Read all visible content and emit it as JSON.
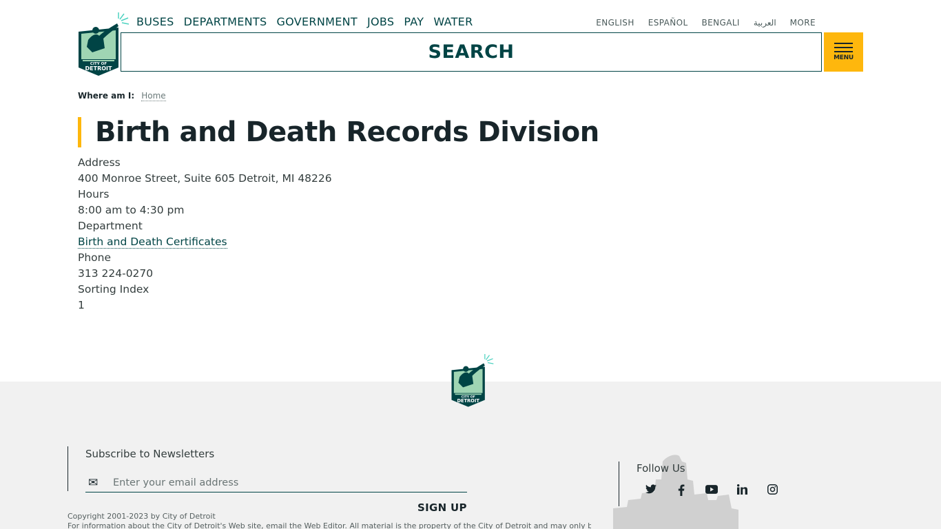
{
  "logo": {
    "text_top": "CITY OF",
    "text_bottom": "DETROIT"
  },
  "topnav": [
    "BUSES",
    "DEPARTMENTS",
    "GOVERNMENT",
    "JOBS",
    "PAY",
    "WATER"
  ],
  "languages": [
    "ENGLISH",
    "ESPAÑOL",
    "BENGALI",
    "العربية",
    "MORE"
  ],
  "search": {
    "label": "SEARCH"
  },
  "menu": {
    "label": "MENU"
  },
  "breadcrumb": {
    "prefix": "Where am I:",
    "home": "Home"
  },
  "page": {
    "title": "Birth and Death Records Division"
  },
  "details": {
    "address_label": "Address",
    "address": "400 Monroe Street, Suite 605 Detroit, MI 48226",
    "hours_label": "Hours",
    "hours": "8:00 am to 4:30 pm",
    "department_label": "Department",
    "department": "Birth and Death Certificates",
    "phone_label": "Phone",
    "phone": "313 224-0270",
    "sorting_label": "Sorting Index",
    "sorting": "1"
  },
  "footer": {
    "newsletter_heading": "Subscribe to Newsletters",
    "email_placeholder": "Enter your email address",
    "signup_label": "SIGN UP",
    "follow_heading": "Follow Us",
    "social_icons": [
      "twitter-icon",
      "facebook-icon",
      "youtube-icon",
      "linkedin-icon",
      "instagram-icon"
    ],
    "copyright": "Copyright 2001-2023 by City of Detroit",
    "notice": "For information about the City of Detroit's Web site, email the Web Editor. All material is the property of the City of Detroit and may only be"
  },
  "colors": {
    "brand_teal": "#004445",
    "accent_yellow": "#feb70d",
    "logo_green": "#9fd5b3",
    "footer_bg": "#f1f1f1"
  }
}
